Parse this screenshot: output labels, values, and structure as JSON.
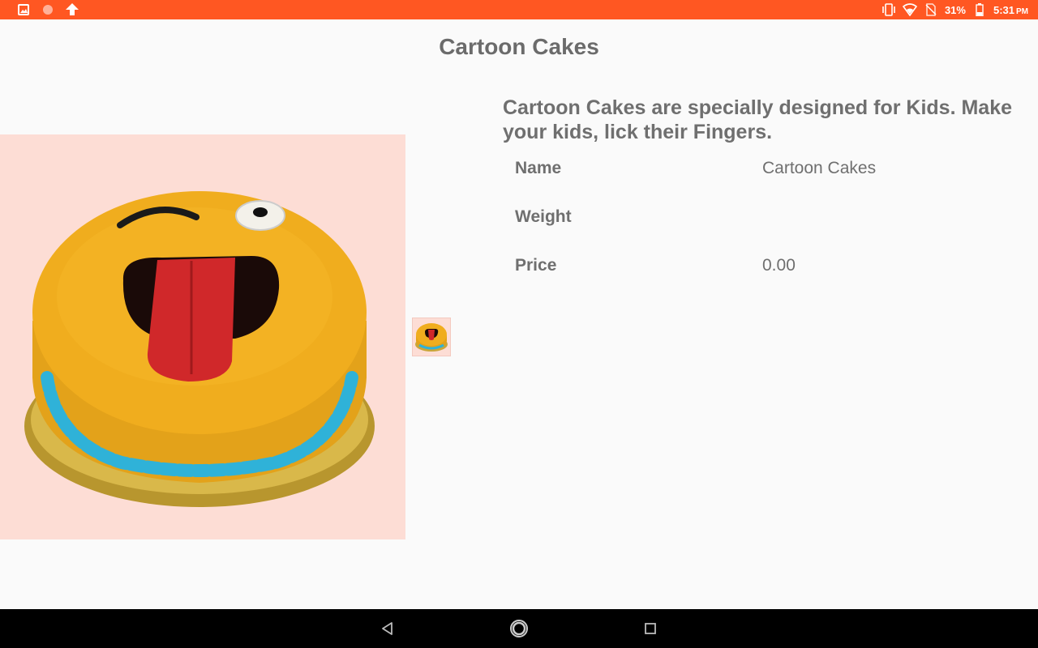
{
  "status_bar": {
    "battery": "31%",
    "time": "5:31",
    "ampm": "PM",
    "color": "#ff5722",
    "left_icons": [
      "image-icon",
      "circle-notification-icon",
      "upload-arrow-icon"
    ],
    "right_icons": [
      "vibrate-icon",
      "wifi-icon",
      "no-sim-icon",
      "battery-icon"
    ]
  },
  "page": {
    "title": "Cartoon Cakes",
    "description": "Cartoon Cakes are specially designed for Kids. Make your kids, lick their Fingers."
  },
  "details": [
    {
      "label": "Name",
      "value": "Cartoon Cakes"
    },
    {
      "label": "Weight",
      "value": ""
    },
    {
      "label": "Price",
      "value": "0.00"
    }
  ],
  "nav_bar": {
    "buttons": [
      "back-icon",
      "home-icon",
      "recents-icon"
    ]
  }
}
